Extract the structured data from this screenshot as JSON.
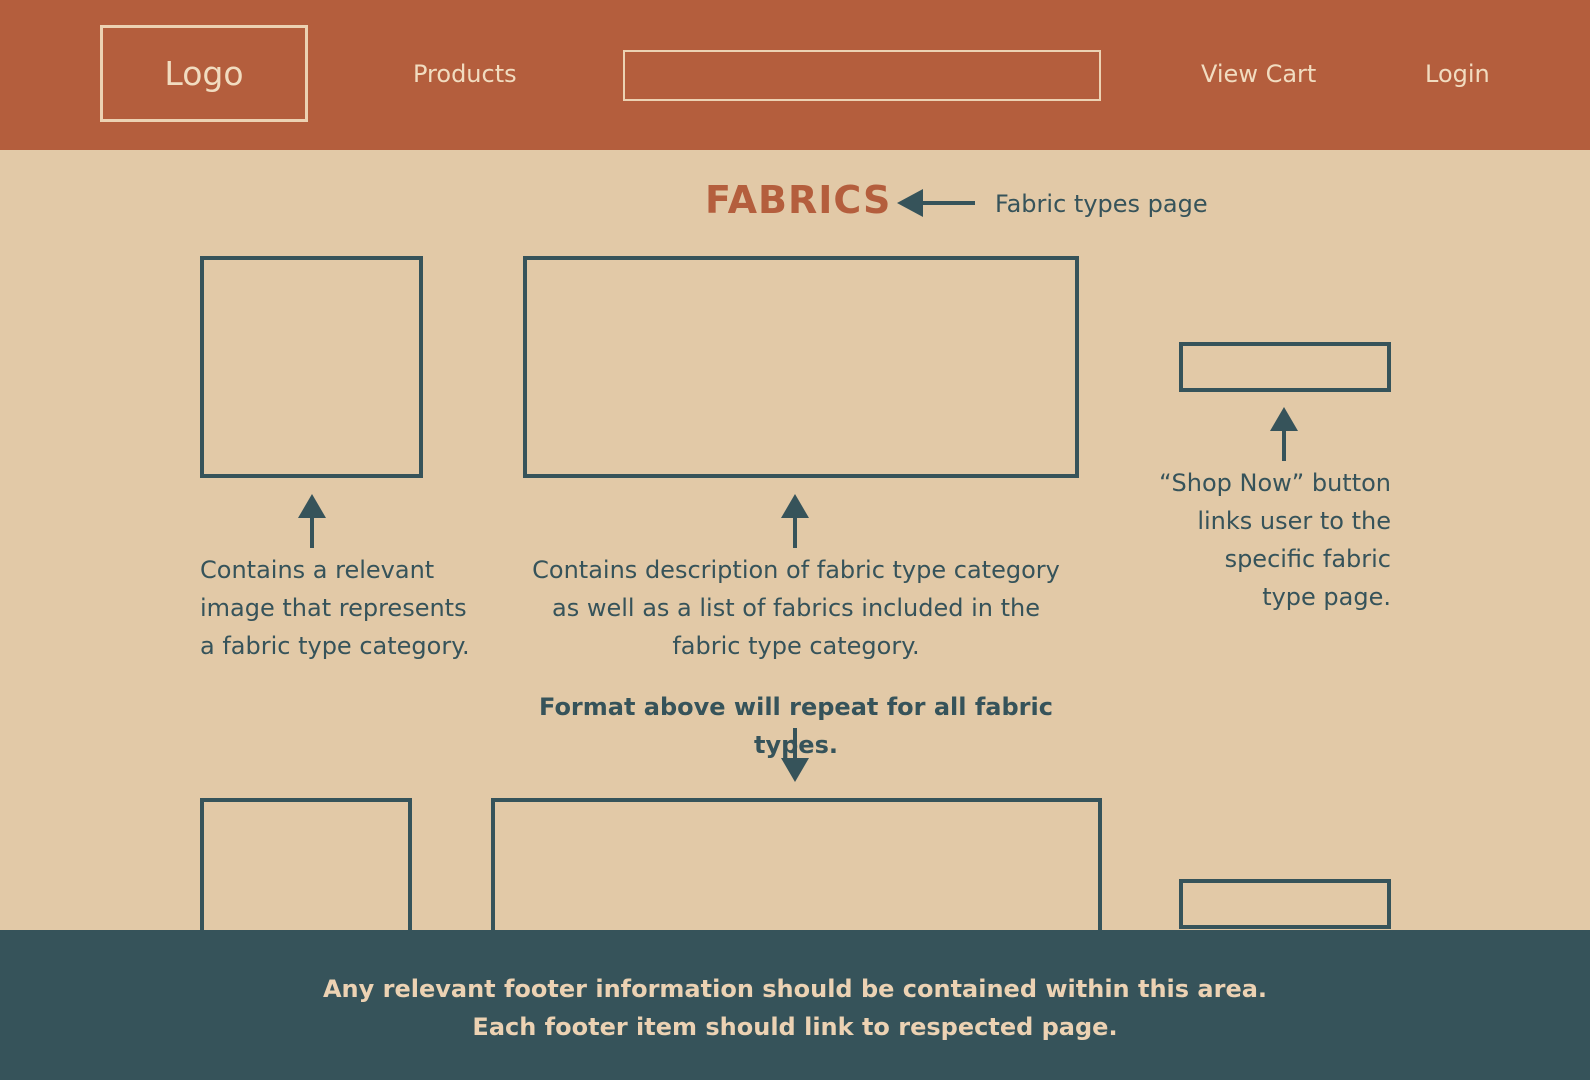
{
  "header": {
    "logo": "Logo",
    "nav": {
      "products": "Products",
      "view_cart": "View Cart",
      "login": "Login"
    }
  },
  "page": {
    "title": "FABRICS",
    "title_note": "Fabric types page"
  },
  "annotations": {
    "image": [
      "Contains a relevant",
      "image that represents",
      "a fabric type category."
    ],
    "description": [
      "Contains description of fabric type category",
      "as well as a list of fabrics included in the",
      "fabric type category."
    ],
    "shop_now": [
      "“Shop Now” button",
      "links user to the",
      "specific fabric",
      "type page."
    ],
    "repeat": "Format above will repeat for all fabric types."
  },
  "footer": {
    "line1": "Any relevant footer information should be contained within this area.",
    "line2": "Each footer item should link to respected page."
  },
  "colors": {
    "header_bg": "#b45e3d",
    "page_bg": "#e2c9a7",
    "footer_bg": "#36535a",
    "outline": "#36535a",
    "header_text": "#f1dcc0"
  }
}
